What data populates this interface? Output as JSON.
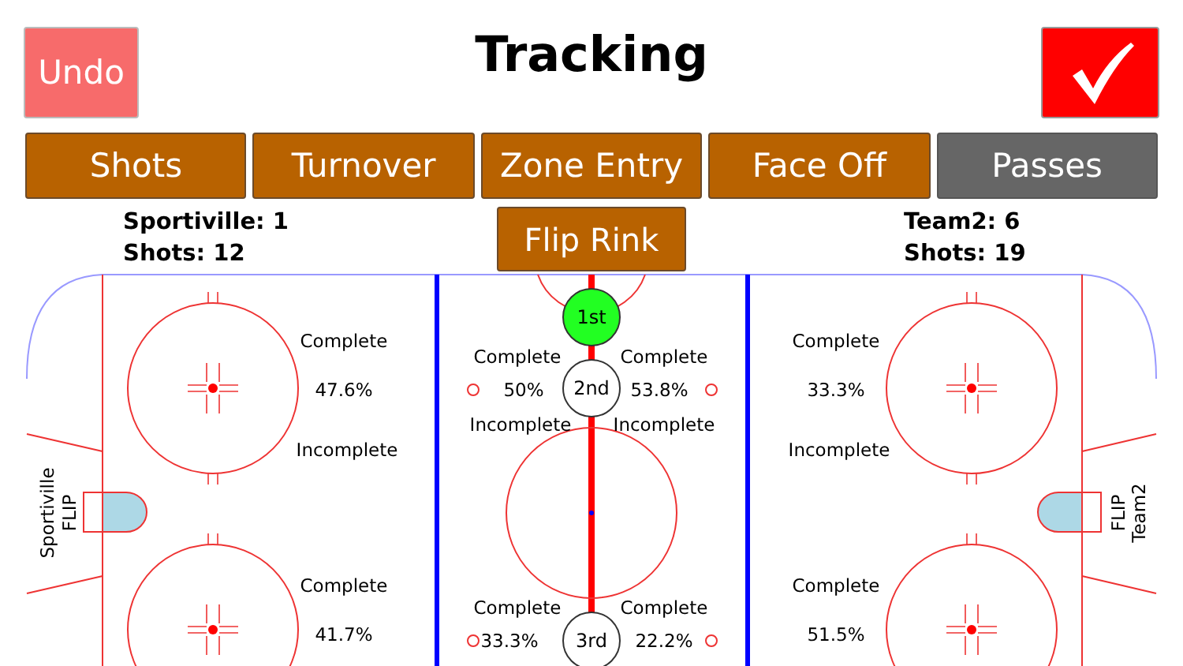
{
  "title": "Tracking",
  "undo_button": "Undo",
  "tabs": [
    {
      "label": "Shots",
      "selected": false
    },
    {
      "label": "Turnover",
      "selected": false
    },
    {
      "label": "Zone Entry",
      "selected": false
    },
    {
      "label": "Face Off",
      "selected": false
    },
    {
      "label": "Passes",
      "selected": true
    }
  ],
  "teams": [
    {
      "score": "Sportiville: 1",
      "shots": "Shots: 12",
      "side_label": "Sportiville",
      "flip_label": "FLIP"
    },
    {
      "score": "Team2: 6",
      "shots": "Shots: 19",
      "side_label": "Team2",
      "flip_label": "FLIP"
    }
  ],
  "flip_button": "Flip Rink",
  "periods": [
    {
      "label": "1st",
      "selected": true
    },
    {
      "label": "2nd",
      "selected": false
    },
    {
      "label": "3rd",
      "selected": false
    }
  ],
  "zones": [
    {
      "complete": "Complete",
      "pct": "47.6%",
      "incomplete": "Incomplete"
    },
    {
      "complete": "Complete",
      "pct": "41.7%"
    },
    {
      "complete": "Complete",
      "pct": "50%",
      "incomplete": "Incomplete"
    },
    {
      "complete": "Complete",
      "pct": "53.8%",
      "incomplete": "Incomplete"
    },
    {
      "complete": "Complete",
      "pct": "33.3%"
    },
    {
      "complete": "Complete",
      "pct": "22.2%"
    },
    {
      "complete": "Complete",
      "pct": "33.3%",
      "incomplete": "Incomplete"
    },
    {
      "complete": "Complete",
      "pct": "51.5%"
    }
  ]
}
